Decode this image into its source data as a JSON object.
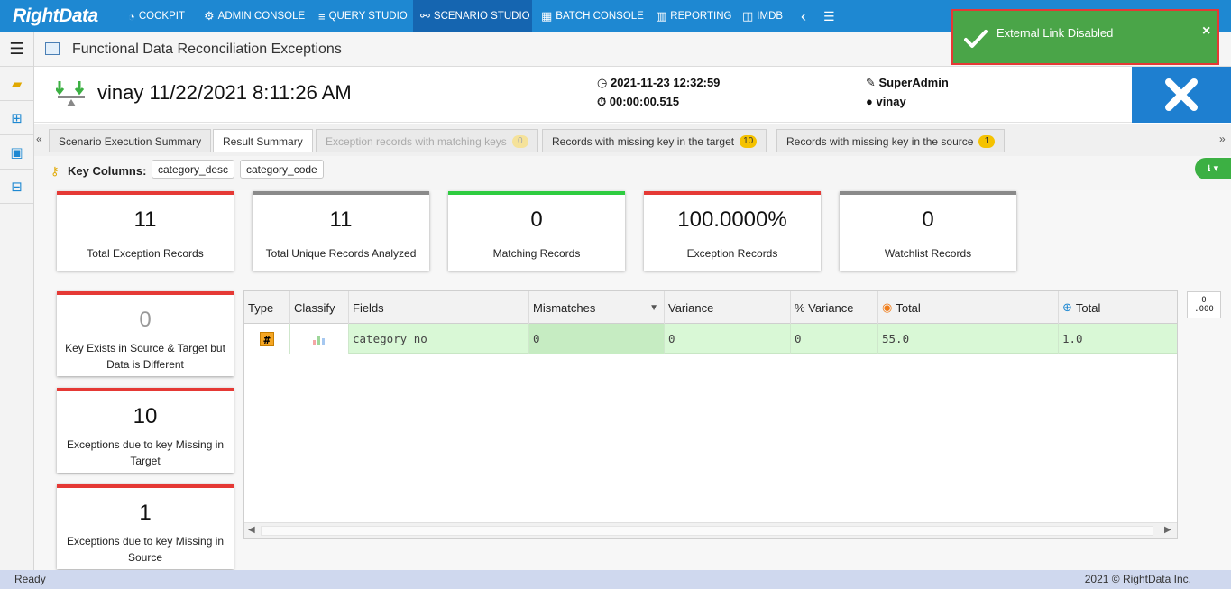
{
  "nav": {
    "logo": "RightData",
    "items": [
      {
        "label": "COCKPIT",
        "icon": "gauge-icon"
      },
      {
        "label": "ADMIN CONSOLE",
        "icon": "gear-icon"
      },
      {
        "label": "QUERY STUDIO",
        "icon": "database-icon"
      },
      {
        "label": "SCENARIO STUDIO",
        "icon": "network-icon"
      },
      {
        "label": "BATCH CONSOLE",
        "icon": "batch-icon"
      },
      {
        "label": "REPORTING",
        "icon": "report-icon"
      },
      {
        "label": "IMDB",
        "icon": "columns-icon"
      }
    ]
  },
  "page": {
    "title": "Functional Data Reconciliation Exceptions"
  },
  "run": {
    "title": "vinay 11/22/2021 8:11:26 AM",
    "datetime": "2021-11-23 12:32:59",
    "duration": "00:00:00.515",
    "role": "SuperAdmin",
    "user": "vinay"
  },
  "tabs": [
    {
      "label": "Scenario Execution Summary"
    },
    {
      "label": "Result Summary"
    },
    {
      "label": "Exception records with matching keys",
      "badge": "0"
    },
    {
      "label": "Records with missing key in the target",
      "badge": "10"
    },
    {
      "label": "Records with missing key in the source",
      "badge": "1"
    }
  ],
  "key_columns": {
    "label": "Key Columns:",
    "chips": [
      "category_desc",
      "category_code"
    ]
  },
  "stats": [
    {
      "value": "11",
      "label": "Total Exception Records",
      "color": "#e53935"
    },
    {
      "value": "11",
      "label": "Total Unique Records Analyzed",
      "color": "#8a8a8a"
    },
    {
      "value": "0",
      "label": "Matching Records",
      "color": "#2ecc40"
    },
    {
      "value": "100.0000%",
      "label": "Exception Records",
      "color": "#e53935"
    },
    {
      "value": "0",
      "label": "Watchlist Records",
      "color": "#8a8a8a"
    }
  ],
  "side_cards": [
    {
      "value": "0",
      "label": "Key Exists in Source & Target but Data is Different"
    },
    {
      "value": "10",
      "label": "Exceptions due to key Missing in Target"
    },
    {
      "value": "1",
      "label": "Exceptions due to key Missing in Source"
    }
  ],
  "grid": {
    "headers": [
      "Type",
      "Classify",
      "Fields",
      "Mismatches",
      "Variance",
      "% Variance",
      "Total",
      "Total"
    ],
    "row": {
      "type_icon": "#",
      "field": "category_no",
      "mismatches": "0",
      "variance": "0",
      "pct_variance": "0",
      "total_source": "55.0",
      "total_target": "1.0"
    }
  },
  "format_button": {
    "top": "0",
    "bottom": ".000"
  },
  "status": {
    "left": "Ready",
    "right": "2021 © RightData Inc."
  },
  "toast": {
    "message": "External Link Disabled",
    "close": "×"
  }
}
